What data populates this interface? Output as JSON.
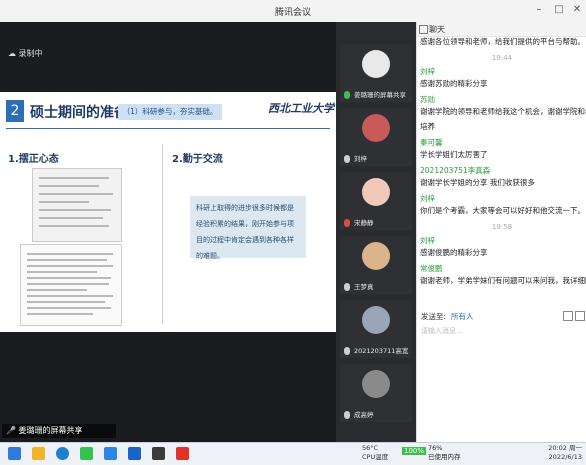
{
  "window": {
    "title": "腾讯会议"
  },
  "share_area": {
    "recording": "录制中",
    "sharing_label": "姜璐珊的屏幕共享"
  },
  "slide": {
    "number": "2",
    "title": "硕士期间的准备",
    "tag": "（1）科研参与，夯实基础。",
    "logo": "西北工业大学",
    "section1": "1.摆正心态",
    "section2": "2.勤于交流",
    "quote": "科研上取得的进步很多时候都是经验积累的结果，刚开始参与项目的过程中肯定会遇到各种各样的难题。"
  },
  "participants": [
    {
      "name": "姜璐珊的屏幕共享",
      "avatar_color": "#e9e9e9"
    },
    {
      "name": "刘梓",
      "avatar_color": "#c85a5a"
    },
    {
      "name": "宋静静",
      "avatar_color": "#f0c9b8"
    },
    {
      "name": "王梦真",
      "avatar_color": "#d9b48a"
    },
    {
      "name": "2021203711高宽",
      "avatar_color": "#9aa6b5"
    },
    {
      "name": "成高婷",
      "avatar_color": "#8a8a8a"
    }
  ],
  "chat": {
    "title": "聊天",
    "messages": [
      {
        "type": "text",
        "text": "感谢各位领导和老师，给我们提供的平台与帮助。"
      },
      {
        "type": "time",
        "text": "19:44"
      },
      {
        "type": "name",
        "text": "刘梓"
      },
      {
        "type": "text",
        "text": "感谢苏勋的精彩分享"
      },
      {
        "type": "name",
        "text": "苏勋"
      },
      {
        "type": "text",
        "text": "谢谢学院的领导和老师给我这个机会，谢谢学院和老师的"
      },
      {
        "type": "text",
        "text": "培养"
      },
      {
        "type": "name",
        "text": "秦可馨"
      },
      {
        "type": "text",
        "text": "学长学姐们太厉害了"
      },
      {
        "type": "name",
        "text": "2021203751李真森"
      },
      {
        "type": "text",
        "text": "谢谢学长学姐的分享 我们收获很多"
      },
      {
        "type": "name",
        "text": "刘梓"
      },
      {
        "type": "text",
        "text": "你们是个考霸，大家等会可以好好和他交流一下。"
      },
      {
        "type": "time",
        "text": "19:58"
      },
      {
        "type": "name",
        "text": "刘梓"
      },
      {
        "type": "text",
        "text": "感谢俊鹏的精彩分享"
      },
      {
        "type": "name",
        "text": "常俊鹏"
      },
      {
        "type": "text",
        "text": "谢谢老师，学弟学妹们有问题可以来问我，我详细回答，"
      }
    ],
    "send_label": "发送至:",
    "send_target": "所有人",
    "input_placeholder": "请输入消息..."
  },
  "taskbar": {
    "temp": "56°C",
    "cpu_label": "CPU温度",
    "battery": "100%",
    "usage": "76%",
    "usage_label": "已使用内存",
    "time": "20:02 周一",
    "date": "2022/6/13"
  }
}
